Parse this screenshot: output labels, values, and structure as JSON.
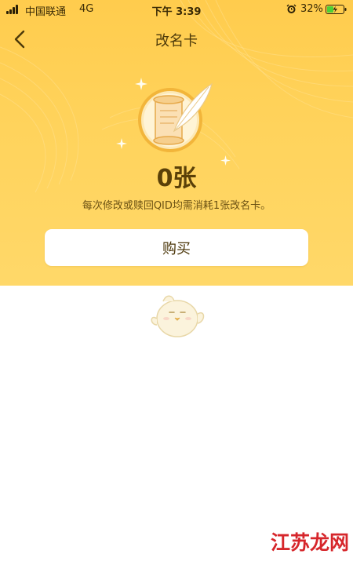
{
  "status_bar": {
    "carrier": "中国联通",
    "network": "4G",
    "time": "下午 3:39",
    "battery": "32%"
  },
  "nav": {
    "title": "改名卡",
    "back_icon": "chevron-left-icon"
  },
  "card": {
    "icon": "scroll-quill-icon",
    "count": "0张",
    "description": "每次修改或赎回QID均需消耗1张改名卡。"
  },
  "buy_button": {
    "label": "购买"
  },
  "illustration": {
    "icon": "chick-mascot-icon"
  },
  "watermark": {
    "text": "江苏龙网"
  },
  "colors": {
    "hero_top": "#ffcc4d",
    "hero_bottom": "#ffd869",
    "button_bg": "#ffffff",
    "text_dark": "#4d3a0a",
    "watermark_red": "#d6262b",
    "battery_green": "#4cd137"
  }
}
